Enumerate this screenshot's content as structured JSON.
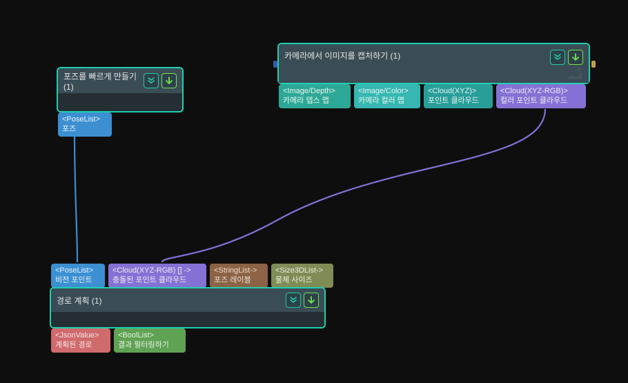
{
  "nodes": {
    "pose": {
      "title": "포즈를 빠르게 만들기 (1)",
      "outputs": [
        {
          "name": "pose-out",
          "type": "<PoseList>",
          "label": "포즈",
          "color": "c-blue"
        }
      ]
    },
    "camera": {
      "title": "카메라에서 이미지를 캡처하기 (1)",
      "outputs": [
        {
          "name": "cam-depth",
          "type": "<Image/Depth>",
          "label": "카메라 뎁스 맵",
          "color": "c-teal1"
        },
        {
          "name": "cam-color",
          "type": "<Image/Color>",
          "label": "카메라 컬러 맵",
          "color": "c-teal2"
        },
        {
          "name": "cam-xyz",
          "type": "<Cloud(XYZ)>",
          "label": "포인트 클라우드",
          "color": "c-tealp"
        },
        {
          "name": "cam-xyzrgb",
          "type": "<Cloud(XYZ-RGB)>",
          "label": "컬러 포인트 클라우드",
          "color": "c-purple"
        }
      ]
    },
    "plan": {
      "title": "경로 계획 (1)",
      "inputs": [
        {
          "name": "in-poselist",
          "type": "<PoseList>",
          "label": "비전 포인트",
          "color": "c-blue"
        },
        {
          "name": "in-cloud",
          "type": "<Cloud(XYZ-RGB) [] ->",
          "label": "충돌된 포인트 클라우드",
          "color": "c-purple"
        },
        {
          "name": "in-strlist",
          "type": "<StringList->",
          "label": "포즈 레이블",
          "color": "c-brown"
        },
        {
          "name": "in-sizelist",
          "type": "<Size3DList->",
          "label": "물체 사이즈",
          "color": "c-olive"
        }
      ],
      "outputs": [
        {
          "name": "out-json",
          "type": "<JsonValue>",
          "label": "계획된 경로",
          "color": "c-rose"
        },
        {
          "name": "out-bool",
          "type": "<BoolList>",
          "label": "결과 필터링하기",
          "color": "c-green"
        }
      ]
    }
  },
  "chart_data": {
    "type": "node-graph",
    "nodes": [
      {
        "id": "pose",
        "title": "포즈를 빠르게 만들기 (1)"
      },
      {
        "id": "camera",
        "title": "카메라에서 이미지를 캡처하기 (1)"
      },
      {
        "id": "plan",
        "title": "경로 계획 (1)"
      }
    ],
    "edges": [
      {
        "from": "pose.포즈 (PoseList)",
        "to": "plan.비전 포인트 (PoseList)",
        "color": "#3c8fd1"
      },
      {
        "from": "camera.컬러 포인트 클라우드 (Cloud XYZ-RGB)",
        "to": "plan.충돌된 포인트 클라우드 (Cloud XYZ-RGB)",
        "color": "#8571d6"
      }
    ]
  }
}
